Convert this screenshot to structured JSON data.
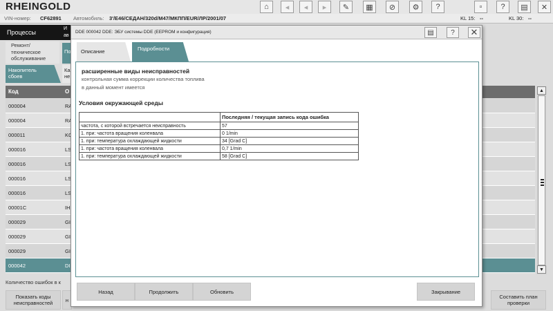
{
  "app": {
    "brand": "RHEINGOLD"
  },
  "infobar": {
    "vin_label": "VIN-номер:",
    "vin_value": "CF62891",
    "car_label": "Автомобиль:",
    "car_value": "3'/E46/СЕДАН/320d/M47/МКПП/EUR/ЛР/2001/07",
    "kl15_label": "KL 15:",
    "kl15_value": "--",
    "kl30_label": "KL 30:",
    "kl30_value": "--"
  },
  "toolbar_icons": [
    "home-icon",
    "back-icon",
    "previous-icon",
    "next-icon",
    "wrench-icon",
    "module-icon",
    "tools-icon",
    "settings-icon",
    "help-icon",
    "mini-icon",
    "print-icon",
    "close-icon"
  ],
  "nav": {
    "processes": "Процессы",
    "processes_partial": "И ав",
    "repair_tab": "Ремонт/\nтехническое\nобслуживание",
    "repair_partial": "По",
    "fault_memory_tab": "Накопитель\nсбоев",
    "fault_partial": "Ка не"
  },
  "table": {
    "headers": [
      "Код",
      "О"
    ],
    "rows": [
      {
        "code": "000004",
        "desc": "RA"
      },
      {
        "code": "000004",
        "desc": "RA"
      },
      {
        "code": "000011",
        "desc": "KC"
      },
      {
        "code": "000016",
        "desc": "LS"
      },
      {
        "code": "000016",
        "desc": "LS"
      },
      {
        "code": "000016",
        "desc": "LS"
      },
      {
        "code": "000016",
        "desc": "LS"
      },
      {
        "code": "00001C",
        "desc": "IH"
      },
      {
        "code": "000029",
        "desc": "GI"
      },
      {
        "code": "000029",
        "desc": "GI"
      },
      {
        "code": "000029",
        "desc": "GI"
      },
      {
        "code": "000042",
        "desc": "DI"
      }
    ]
  },
  "fault_count": "Количество ошибок в к",
  "bottom_buttons": {
    "show_codes": "Показать коды\nнеисправностей",
    "partial": "н",
    "plan": "Составить план\nпроверки"
  },
  "dialog": {
    "title": "DDE 000042 DDE: ЭБУ системы DDE (EEPROM и конфигурация)",
    "tabs": [
      "Описание",
      "Подробности"
    ],
    "fault_title": "расширенные виды неисправностей",
    "fault_sub1": "контрольная сумма коррекции количества топлива",
    "fault_sub2": "в данный момент имеется",
    "env_title": "Условия окружающей среды",
    "env_header": "Последняя / текущая запись кода ошибка",
    "env_rows": [
      {
        "label": "частота, с которой встречается неисправность",
        "value": "57"
      },
      {
        "label": "1. при: частота вращения коленвала",
        "value": "0 1/min"
      },
      {
        "label": "1. при: температура охлаждающей жидкости",
        "value": "34 [Grad C]"
      },
      {
        "label": "1. при: частота вращения коленвала",
        "value": "0,7 1/min"
      },
      {
        "label": "1. при: температура охлаждающей жидкости",
        "value": "58 [Grad C]"
      }
    ],
    "buttons": {
      "back": "Назад",
      "continue": "Продолжить",
      "refresh": "Обновить",
      "close": "Закрывание"
    }
  },
  "colors": {
    "accent": "#5b8f93",
    "selected_row": "#5b8f93",
    "header": "#6d6d6d"
  }
}
